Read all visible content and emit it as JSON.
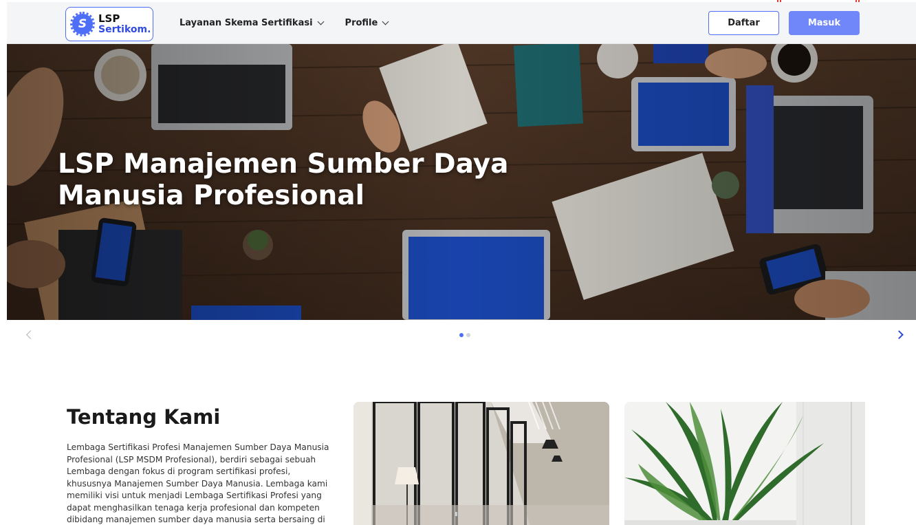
{
  "header": {
    "logo": {
      "line1": "LSP",
      "line2": "Sertikom.",
      "mark": "S"
    },
    "nav": [
      {
        "label": "Layanan Skema Sertifikasi",
        "icon": "chevron-down-icon"
      },
      {
        "label": "Profile",
        "icon": "chevron-down-icon"
      }
    ],
    "register_label": "Daftar",
    "login_label": "Masuk"
  },
  "hero": {
    "title_line1": "LSP Manajemen Sumber Daya",
    "title_line2": "Manusia Profesional",
    "slides": 2,
    "active_slide": 1
  },
  "carousel": {
    "prev_icon": "chevron-left-icon",
    "next_icon": "chevron-right-icon"
  },
  "about": {
    "title": "Tentang Kami",
    "body": "Lembaga Sertifikasi Profesi Manajemen Sumber Daya Manusia Profesional (LSP MSDM Profesional), berdiri sebagai sebuah Lembaga dengan fokus di program sertifikasi profesi, khususnya Manajemen Sumber Daya Manusia. Lembaga kami memiliki visi untuk menjadi Lembaga Sertifikasi Profesi yang dapat menghasilkan tenaga kerja profesional dan kompeten dibidang manajemen sumber daya manusia serta bersaing di"
  },
  "colors": {
    "accent": "#4f6ef7",
    "accent_dark": "#2f4be0",
    "login_bg": "#6f87f9",
    "header_bg": "#f4f5f7",
    "corner_marks": "#e53935"
  }
}
